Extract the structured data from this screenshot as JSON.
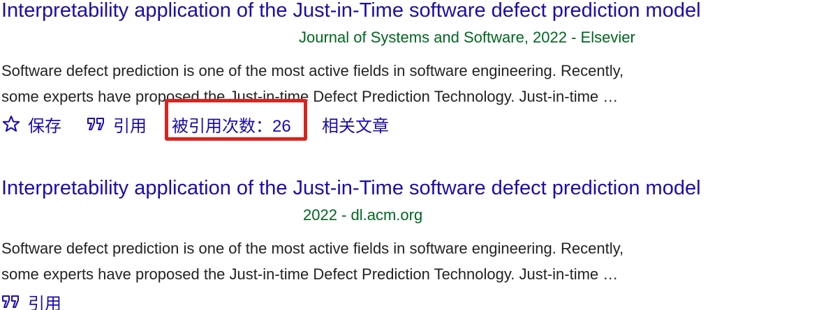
{
  "results": [
    {
      "title": "Interpretability application of the Just-in-Time software defect prediction model",
      "source": "Journal of Systems and Software, 2022 - Elsevier",
      "snippet_lines": [
        "Software defect prediction is one of the most active fields in software engineering. Recently,",
        "some experts have proposed the Just-in-time Defect Prediction Technology. Just-in-time …"
      ],
      "actions": {
        "save": "保存",
        "cite": "引用",
        "cited_by": "被引用次数：26",
        "related": "相关文章"
      }
    },
    {
      "title": "Interpretability application of the Just-in-Time software defect prediction model",
      "source": "2022 - dl.acm.org",
      "snippet_lines": [
        "Software defect prediction is one of the most active fields in software engineering. Recently,",
        "some experts have proposed the Just-in-time Defect Prediction Technology. Just-in-time …"
      ],
      "actions": {
        "cite": "引用"
      }
    }
  ],
  "colors": {
    "link": "#1a0dab",
    "source": "#006621",
    "text": "#222222",
    "highlight": "#d9241e"
  },
  "icons": {
    "save": "star-outline-icon",
    "cite": "quote-icon"
  }
}
